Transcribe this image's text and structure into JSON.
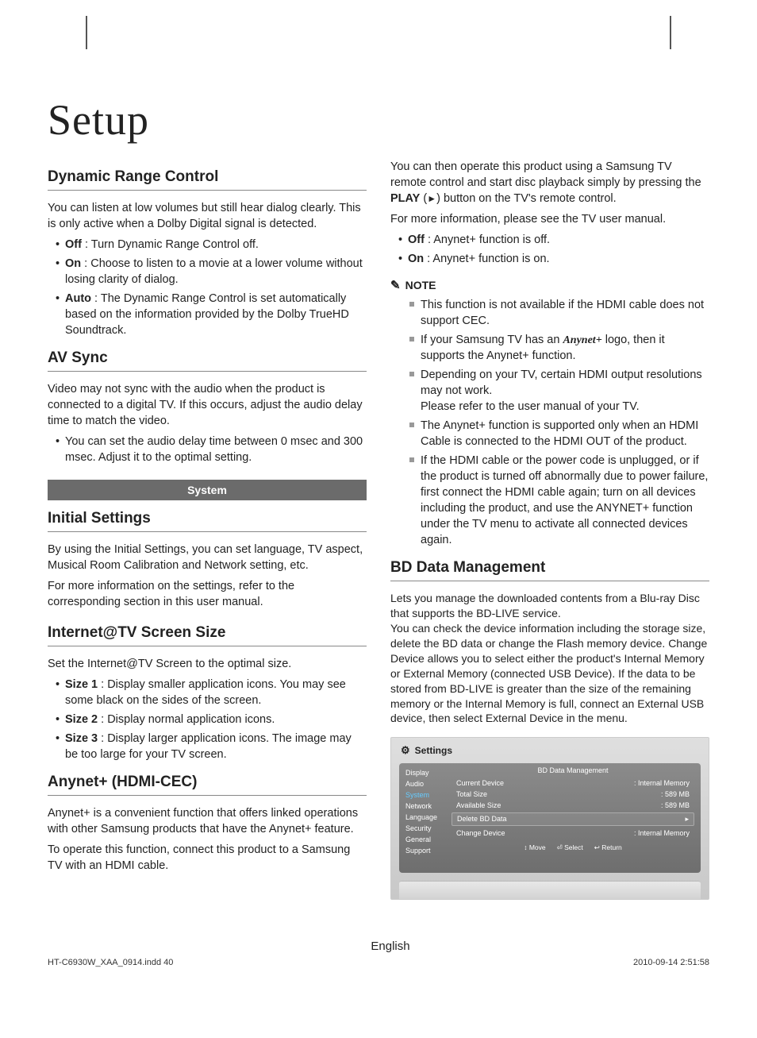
{
  "page_title": "Setup",
  "col1": {
    "h_drc": "Dynamic Range Control",
    "p_drc": "You can listen at low volumes but still hear dialog clearly. This is only active when a Dolby Digital signal is detected.",
    "drc_bullets": [
      {
        "b": "Off",
        "t": " : Turn Dynamic Range Control off."
      },
      {
        "b": "On",
        "t": " : Choose to listen to a movie at a lower volume without losing clarity of dialog."
      },
      {
        "b": "Auto",
        "t": " : The Dynamic Range Control is set automatically based on the information provided by the Dolby TrueHD Soundtrack."
      }
    ],
    "h_av": "AV Sync",
    "p_av": "Video may not sync with the audio when the product is connected to a digital TV. If this occurs, adjust the audio delay time to match the video.",
    "av_bullets": [
      {
        "b": "",
        "t": "You can set the audio delay time between 0 msec and 300 msec. Adjust it to the optimal setting."
      }
    ],
    "bar": "System",
    "h_init": "Initial Settings",
    "p_init1": "By using the Initial Settings, you can set language, TV aspect, Musical Room Calibration and Network setting, etc.",
    "p_init2": "For more information on the settings, refer to the corresponding section in this user manual.",
    "h_itv": "Internet@TV Screen Size",
    "p_itv": "Set the Internet@TV Screen to the optimal size.",
    "itv_bullets": [
      {
        "b": "Size 1",
        "t": " : Display smaller application icons. You may see some black on the sides of the screen."
      },
      {
        "b": "Size 2",
        "t": " : Display normal application icons."
      },
      {
        "b": "Size 3",
        "t": " : Display larger application icons. The image may be too large for your TV screen."
      }
    ],
    "h_any": "Anynet+ (HDMI-CEC)",
    "p_any1": "Anynet+ is a convenient function that offers linked operations with other Samsung products that have the Anynet+ feature.",
    "p_any2": "To operate this function, connect this product to a Samsung TV with an HDMI cable."
  },
  "col2": {
    "p_top1a": "You can then operate this product using a Samsung TV remote control and start disc playback simply by pressing the ",
    "p_top1b": "PLAY",
    "p_top1c": " (",
    "play_glyph": "►",
    "p_top1d": ") button on the TV's remote control.",
    "p_top2": "For more information, please see the TV user manual.",
    "top_bullets": [
      {
        "b": "Off",
        "t": " : Anynet+ function is off."
      },
      {
        "b": "On",
        "t": " : Anynet+ function is on."
      }
    ],
    "note_label": "NOTE",
    "note_bullets": [
      "This function is not available if the HDMI cable does not support CEC.",
      "If your Samsung TV has an Anynet+ logo, then it supports the Anynet+ function.",
      "Depending on your TV, certain HDMI output resolutions may not work.\nPlease refer to the user manual of your TV.",
      "The Anynet+ function is supported only when an HDMI Cable is connected to the HDMI OUT of the product.",
      "If the HDMI cable or the power code is unplugged, or if the product is turned off abnormally due to power failure, first connect the HDMI cable again; turn on all devices including the product, and use the ANYNET+ function under the TV menu to activate all connected devices again."
    ],
    "anynet_logo_text": "Anynet+",
    "h_bd": "BD Data Management",
    "p_bd": "Lets you manage the downloaded contents from a Blu-ray Disc that supports the BD-LIVE service.\nYou can check the device information including the storage size, delete the BD data or change the Flash memory device. Change Device allows you to select either the product's Internal Memory or External Memory (connected USB Device). If the data to be stored from BD-LIVE is greater than the size of the remaining memory or the Internal Memory is full, connect an External USB device, then select External Device in the menu."
  },
  "settings": {
    "header": "Settings",
    "menu": [
      "Display",
      "Audio",
      "System",
      "Network",
      "Language",
      "Security",
      "General",
      "Support"
    ],
    "selected": "System",
    "panel_title": "BD Data Management",
    "rows": [
      {
        "k": "Current Device",
        "v": ": Internal Memory"
      },
      {
        "k": "Total Size",
        "v": ": 589 MB"
      },
      {
        "k": "Available Size",
        "v": ": 589 MB"
      }
    ],
    "delete_row": "Delete BD Data",
    "delete_arrow": "▸",
    "change_row": {
      "k": "Change Device",
      "v": ": Internal Memory"
    },
    "footer": [
      {
        "glyph": "↕",
        "txt": "Move"
      },
      {
        "glyph": "⏎",
        "txt": "Select"
      },
      {
        "glyph": "↩",
        "txt": "Return"
      }
    ]
  },
  "foot_lang": "English",
  "foot_left": "HT-C6930W_XAA_0914.indd   40",
  "foot_right": "2010-09-14   2:51:58"
}
